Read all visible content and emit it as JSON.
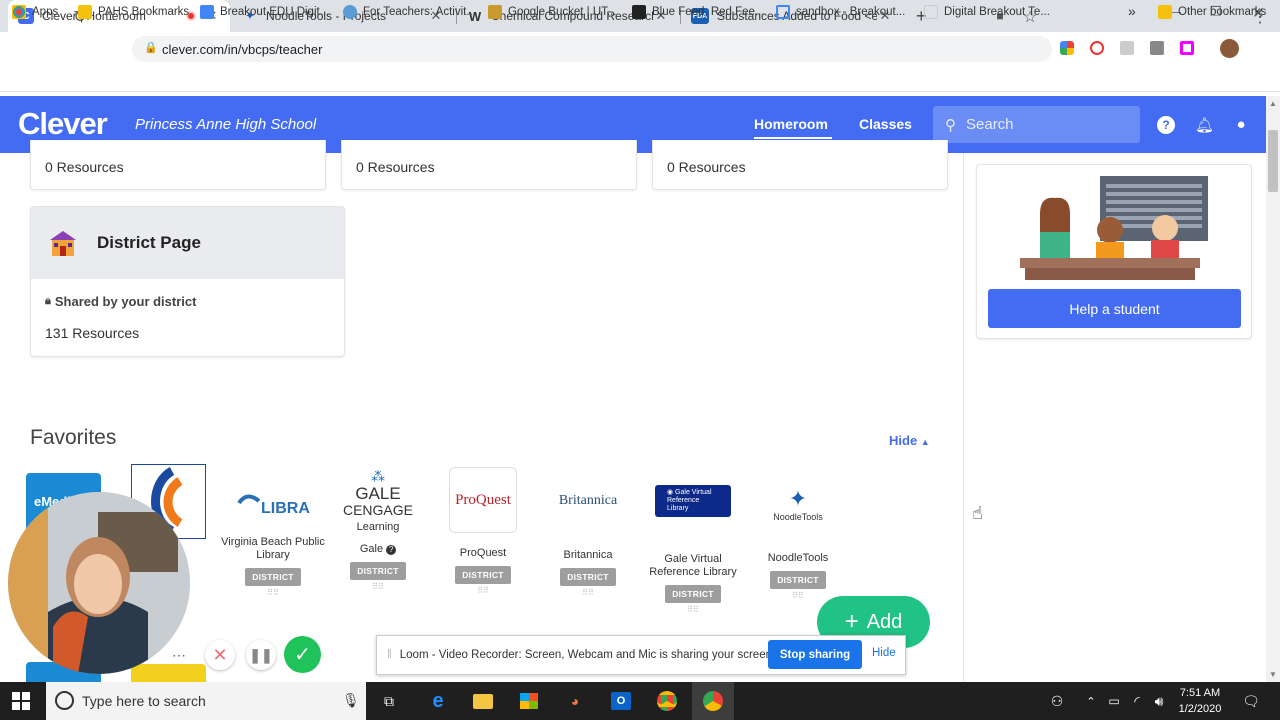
{
  "browser": {
    "tabs": [
      {
        "title": "Clever | Homeroom",
        "favicon": "C",
        "fav_color": "#436cf2",
        "active": true
      },
      {
        "title": "NoodleTools - Projects",
        "favicon": "✦",
        "fav_color": "#1a5fb4",
        "active": false
      },
      {
        "title": "Chemical Compound Research -",
        "favicon": "W",
        "fav_color": "#333333",
        "active": false
      },
      {
        "title": "Substances Added to Food <em",
        "favicon": "FDA",
        "fav_color": "#1a5fb4",
        "active": false
      }
    ],
    "new_tab": "+",
    "url": "clever.com/in/vbcps/teacher",
    "bookmarks": [
      {
        "label": "Apps",
        "color": "#ea4335"
      },
      {
        "label": "PAHS Bookmarks",
        "color": "#f4c20d"
      },
      {
        "label": "Breakout EDU Digit...",
        "color": "#4285f4"
      },
      {
        "label": "For Teachers: Activit...",
        "color": "#5b9bd5"
      },
      {
        "label": "Google Bucket | UT...",
        "color": "#c99a2e"
      },
      {
        "label": "Blue Feed, Red Fee...",
        "color": "#222222"
      },
      {
        "label": "sandbox - Breakout...",
        "color": "#4285f4"
      },
      {
        "label": "Digital Breakout Te...",
        "color": "#dddddd"
      }
    ],
    "more_bookmarks": "»",
    "other_bookmarks": "Other bookmarks"
  },
  "header": {
    "logo": "Clever",
    "school": "Princess Anne High School",
    "nav": [
      "Homeroom",
      "Classes"
    ],
    "search_placeholder": "Search"
  },
  "top_cards": [
    {
      "resources": "0 Resources"
    },
    {
      "resources": "0 Resources"
    },
    {
      "resources": "0 Resources"
    }
  ],
  "district_card": {
    "title": "District Page",
    "shared": "Shared by your district",
    "resources": "131 Resources"
  },
  "help": {
    "button": "Help a student"
  },
  "favorites": {
    "title": "Favorites",
    "hide": "Hide",
    "apps": [
      {
        "name": "Virginia Beach Public Library",
        "badge": "DISTRICT"
      },
      {
        "name": "Gale",
        "badge": "DISTRICT"
      },
      {
        "name": "ProQuest",
        "badge": "DISTRICT"
      },
      {
        "name": "Britannica",
        "badge": "DISTRICT"
      },
      {
        "name": "Gale Virtual Reference Library",
        "badge": "DISTRICT"
      },
      {
        "name": "NoodleTools",
        "badge": "DISTRICT"
      }
    ],
    "emedia_label": "eMedi"
  },
  "add_button": "Add",
  "loom": {
    "message": "Loom - Video Recorder: Screen, Webcam and Mic is sharing your screen.",
    "stop": "Stop sharing",
    "hide": "Hide"
  },
  "taskbar": {
    "search_placeholder": "Type here to search",
    "time": "7:51 AM",
    "date": "1/2/2020"
  },
  "colors": {
    "clever_blue": "#436cf2",
    "add_green": "#20c285"
  }
}
